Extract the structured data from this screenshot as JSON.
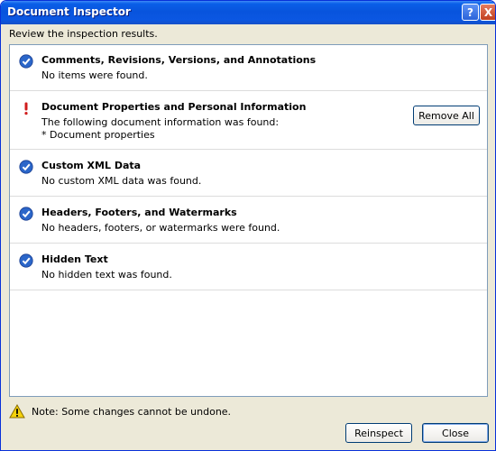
{
  "window": {
    "title": "Document Inspector"
  },
  "titlebar": {
    "help_glyph": "?",
    "close_glyph": "X"
  },
  "subtitle": "Review the inspection results.",
  "results": [
    {
      "status": "ok",
      "heading": "Comments, Revisions, Versions, and Annotations",
      "lines": [
        "No items were found."
      ]
    },
    {
      "status": "found",
      "heading": "Document Properties and Personal Information",
      "lines": [
        "The following document information was found:",
        "* Document properties"
      ],
      "action": "Remove All"
    },
    {
      "status": "ok",
      "heading": "Custom XML Data",
      "lines": [
        "No custom XML data was found."
      ]
    },
    {
      "status": "ok",
      "heading": "Headers, Footers, and Watermarks",
      "lines": [
        "No headers, footers, or watermarks were found."
      ]
    },
    {
      "status": "ok",
      "heading": "Hidden Text",
      "lines": [
        "No hidden text was found."
      ]
    }
  ],
  "note": "Note: Some changes cannot be undone.",
  "buttons": {
    "reinspect": "Reinspect",
    "close": "Close"
  },
  "colors": {
    "titlebar": "#0854dd",
    "check": "#2b66c9",
    "warning": "#d01c1c",
    "border": "#7f9db9"
  }
}
